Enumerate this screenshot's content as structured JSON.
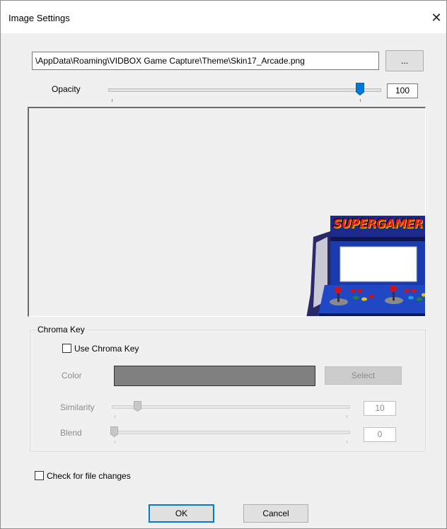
{
  "window": {
    "title": "Image Settings",
    "close_glyph": "✕"
  },
  "file": {
    "path": "\\AppData\\Roaming\\VIDBOX Game Capture\\Theme\\Skin17_Arcade.png",
    "browse_label": "..."
  },
  "opacity": {
    "label": "Opacity",
    "value": "100",
    "level": 1.0
  },
  "preview": {
    "logo_word_1": "SUPER",
    "logo_word_2": "GAMER"
  },
  "chroma": {
    "group_title": "Chroma Key",
    "use_label": "Use Chroma Key",
    "use_checked": false,
    "color_label": "Color",
    "color_value": "#808080",
    "select_label": "Select",
    "similarity_label": "Similarity",
    "similarity_value": "10",
    "blend_label": "Blend",
    "blend_value": "0"
  },
  "watch": {
    "label": "Check for file changes",
    "checked": false
  },
  "buttons": {
    "ok": "OK",
    "cancel": "Cancel"
  },
  "colors": {
    "accent": "#0078d7",
    "dialog_bg": "#f0f0f0"
  },
  "icons": {
    "close": "close-icon",
    "slider_thumb": "slider-thumb-icon"
  }
}
